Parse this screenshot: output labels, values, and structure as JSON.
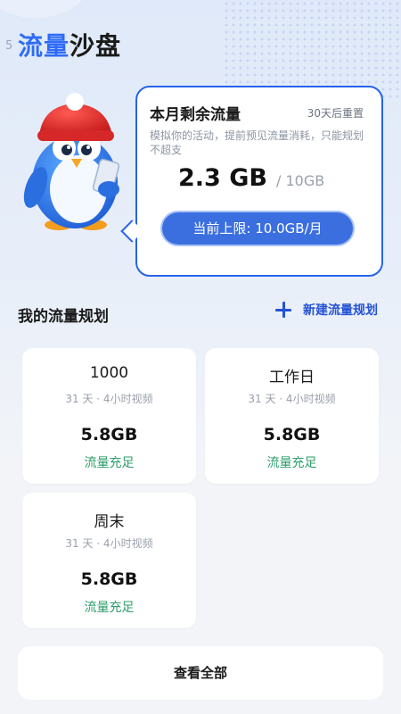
{
  "status_bar": {
    "time_fragment": "5"
  },
  "app": {
    "title_highlight": "流量",
    "title_rest": "沙盘"
  },
  "mascot": {
    "name": "penguin-mascot-icon"
  },
  "summary": {
    "title": "本月剩余流量",
    "reset_text": "30天后重置",
    "description": "模拟你的活动，提前预见流量消耗，只能规划不超支",
    "remaining": "2.3 GB",
    "total": "/ 10GB",
    "limit_label": "当前上限: 10.0GB/月"
  },
  "plans_section": {
    "title": "我的流量规划",
    "new_plan_label": "新建流量规划"
  },
  "plans": [
    {
      "name": "1000",
      "meta": "31 天 · 4小时视频",
      "usage": "5.8GB",
      "status": "流量充足"
    },
    {
      "name": "工作日",
      "meta": "31 天 · 4小时视频",
      "usage": "5.8GB",
      "status": "流量充足"
    },
    {
      "name": "周末",
      "meta": "31 天 · 4小时视频",
      "usage": "5.8GB",
      "status": "流量充足"
    }
  ],
  "view_all_label": "查看全部",
  "colors": {
    "accent": "#2f6cf5",
    "link": "#2452d6",
    "success": "#2e9e6b",
    "pill": "#3b6fe0"
  }
}
